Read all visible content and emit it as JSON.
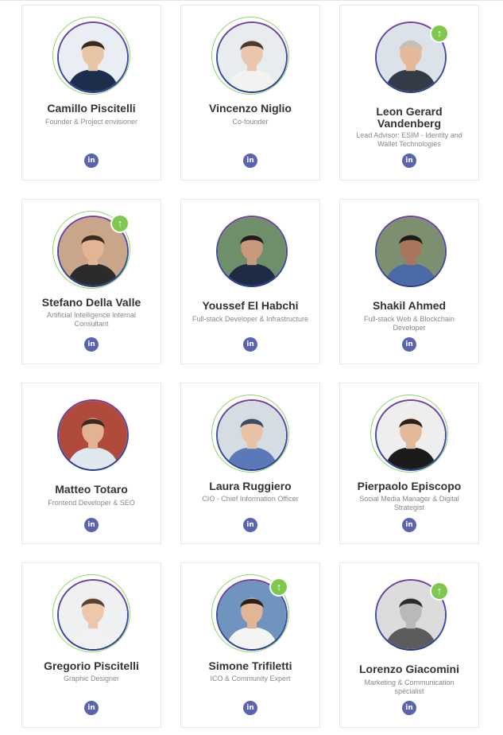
{
  "icons": {
    "linkedin": "in",
    "up": "↑"
  },
  "team": [
    {
      "name": "Camillo Piscitelli",
      "role": "Founder & Project envisioner",
      "bg": "#e9eef4",
      "skin": "#e8c4a6",
      "hair": "#3a2a20",
      "shirt": "#1f2d4d"
    },
    {
      "name": "Vincenzo Niglio",
      "role": "Co-founder",
      "bg": "#e7ecef",
      "skin": "#eac6ad",
      "hair": "#4a3a30",
      "shirt": "#f2f2f2"
    },
    {
      "name": "Leon Gerard Vandenberg",
      "role": "Lead Advisor: ESIM - Identity and Wallet Technologies",
      "bg": "#dbe2e8",
      "skin": "#e6b89a",
      "hair": "#bfbfbf",
      "shirt": "#333b47"
    },
    {
      "name": "Stefano Della Valle",
      "role": "Artificial Intelligence Internal Consultant",
      "bg": "#c9a58a",
      "skin": "#e3b594",
      "hair": "#3b2a1e",
      "shirt": "#2b2b2b"
    },
    {
      "name": "Youssef El Habchi",
      "role": "Full-stack Developer & Infrastructure",
      "bg": "#6f8f6a",
      "skin": "#c69a7a",
      "hair": "#1e1e1e",
      "shirt": "#1f2a44"
    },
    {
      "name": "Shakil Ahmed",
      "role": "Full-stack Web & Blockchain Developer",
      "bg": "#7c8f6e",
      "skin": "#a8765a",
      "hair": "#1b1b1b",
      "shirt": "#4b6aa8"
    },
    {
      "name": "Matteo Totaro",
      "role": "Frontend Developer & SEO",
      "bg": "#b04a3a",
      "skin": "#e2b293",
      "hair": "#3a2a20",
      "shirt": "#dfe7ef"
    },
    {
      "name": "Laura Ruggiero",
      "role": "CIO - Chief Information Officer",
      "bg": "#d6dde2",
      "skin": "#e8c2a4",
      "hair": "#3b4a6b",
      "shirt": "#5b79b8"
    },
    {
      "name": "Pierpaolo Episcopo",
      "role": "Social Media Manager & Digital Strategist",
      "bg": "#eeeeee",
      "skin": "#e4b99a",
      "hair": "#2a2018",
      "shirt": "#1b1b1b"
    },
    {
      "name": "Gregorio Piscitelli",
      "role": "Graphic Designer",
      "bg": "#eef0f2",
      "skin": "#ecc7ab",
      "hair": "#5a4030",
      "shirt": "#f1f1f1"
    },
    {
      "name": "Simone Trifiletti",
      "role": "ICO & Community Expert",
      "bg": "#6f95bf",
      "skin": "#e1b596",
      "hair": "#2a2018",
      "shirt": "#f4f4f4"
    },
    {
      "name": "Lorenzo Giacomini",
      "role": "Marketing & Communication specialist",
      "bg": "#dcdcdc",
      "skin": "#b9b9b9",
      "hair": "#2b2b2b",
      "shirt": "#5c5c5c"
    }
  ]
}
